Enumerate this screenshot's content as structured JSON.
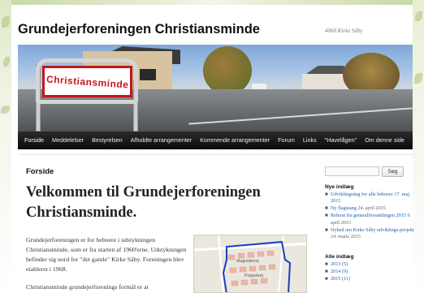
{
  "site": {
    "title": "Grundejerforeningen Christiansminde",
    "description": "4060 Kirke Såby"
  },
  "banner": {
    "sign_text": "Christiansminde"
  },
  "nav": {
    "items": [
      {
        "label": "Forside"
      },
      {
        "label": "Meddelelser"
      },
      {
        "label": "Bestyrelsen"
      },
      {
        "label": "Afholdte arrangementer"
      },
      {
        "label": "Kommende arrangementer"
      },
      {
        "label": "Forum"
      },
      {
        "label": "Links"
      },
      {
        "label": "\"Havelågen\""
      },
      {
        "label": "Om denne side"
      }
    ]
  },
  "main": {
    "section_label": "Forside",
    "title": "Velkommen til Grundejerforeningen Christiansminde.",
    "paragraph1": "Grundejerforeningen er for beboere i udstykningen Christiansminde, som er fra starten af 1960'erne. Udstykningen befinder sig nord for \"det gamle\" Kirke Såby. Foreningen blev etableret i 1968.",
    "paragraph2": "Christiansminde grundejerforenings formål er at",
    "map": {
      "labels": [
        "Magnolievej",
        "Poppelvej"
      ]
    }
  },
  "sidebar": {
    "search": {
      "placeholder": "",
      "button_label": "Søg"
    },
    "recent_title": "Nye indlæg",
    "recent_posts": [
      {
        "title": "Udviklingsdag for alle beboere 17. maj 2015",
        "date": ""
      },
      {
        "title": "Ny flagstang",
        "date": "24. april 2015"
      },
      {
        "title": "Referat fra generalforsamlingen 2015",
        "date": "9. april 2015"
      },
      {
        "title": "Nyhed om Kirke Såby udviklings-projekt",
        "date": "24. marts 2015"
      }
    ],
    "archive_title": "Alle indlæg",
    "archive": [
      {
        "label": "2013 (5)"
      },
      {
        "label": "2014 (9)"
      },
      {
        "label": "2015 (11)"
      }
    ]
  }
}
